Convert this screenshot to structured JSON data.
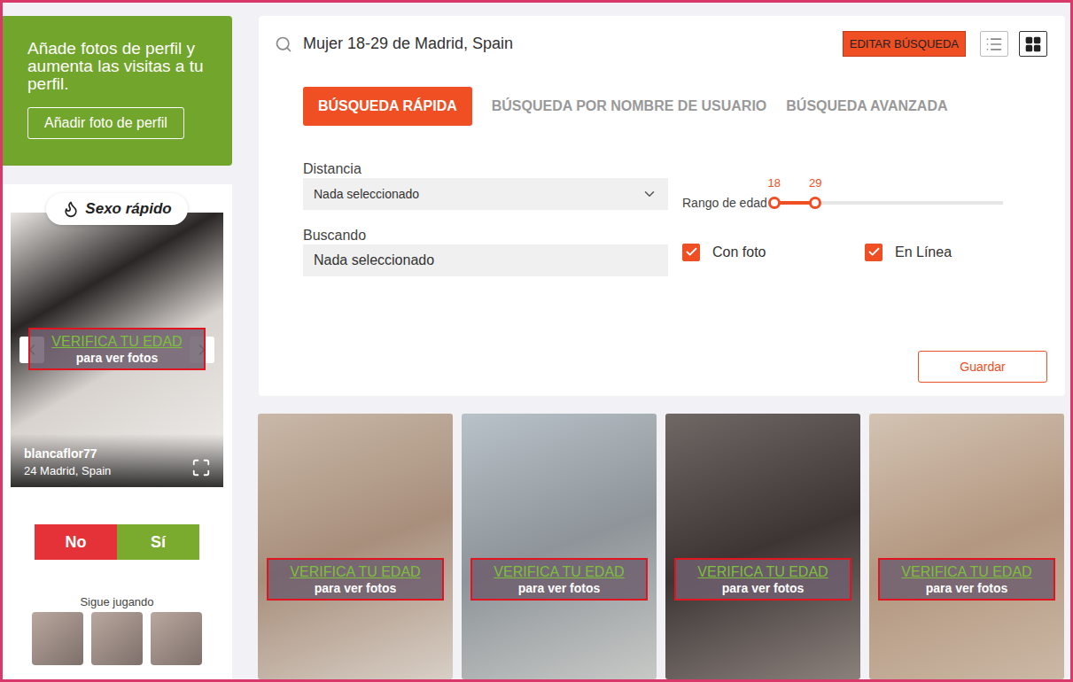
{
  "sidebar": {
    "promo": {
      "text": "Añade fotos de perfil y aumenta las visitas a tu perfil.",
      "button": "Añadir foto de perfil"
    },
    "quick_game": {
      "title": "Sexo rápido",
      "verify": "VERIFICA TU EDAD",
      "note": "para ver fotos",
      "username": "blancaflor77",
      "details": "24 Madrid, Spain",
      "buttons": [
        {
          "label": "No",
          "kind": "no"
        },
        {
          "label": "Sí",
          "kind": "yes"
        }
      ],
      "keep_playing": "Sigue jugando",
      "thumbnails": [
        {
          "blurred": true
        },
        {
          "blurred": true
        },
        {
          "blurred": true
        }
      ]
    }
  },
  "search": {
    "query": "Mujer 18-29 de Madrid, Spain",
    "edit_button": "EDITAR BÚSQUEDA",
    "views": [
      {
        "kind": "list",
        "selected": false
      },
      {
        "kind": "grid",
        "selected": true
      }
    ]
  },
  "tabs": [
    {
      "label": "BÚSQUEDA RÁPIDA",
      "selected": true
    },
    {
      "label": "BÚSQUEDA POR NOMBRE DE USUARIO",
      "selected": false
    },
    {
      "label": "BÚSQUEDA AVANZADA",
      "selected": false
    }
  ],
  "filters": {
    "distance": {
      "label": "Distancia",
      "value": "Nada seleccionado"
    },
    "looking": {
      "label": "Buscando",
      "value": "Nada seleccionado"
    },
    "age": {
      "label": "Rango de edad",
      "min": "18",
      "max": "29",
      "low": 0,
      "high": 0.18
    },
    "checkboxes": [
      {
        "label": "Con foto",
        "checked": true
      },
      {
        "label": "En Línea",
        "checked": true
      }
    ],
    "save": "Guardar"
  },
  "results": [
    {
      "verify": "VERIFICA TU EDAD",
      "note": "para ver fotos",
      "blurred": true
    },
    {
      "verify": "VERIFICA TU EDAD",
      "note": "para ver fotos",
      "blurred": true
    },
    {
      "verify": "VERIFICA TU EDAD",
      "note": "para ver fotos",
      "blurred": true
    },
    {
      "verify": "VERIFICA TU EDAD",
      "note": "para ver fotos",
      "blurred": true
    }
  ]
}
